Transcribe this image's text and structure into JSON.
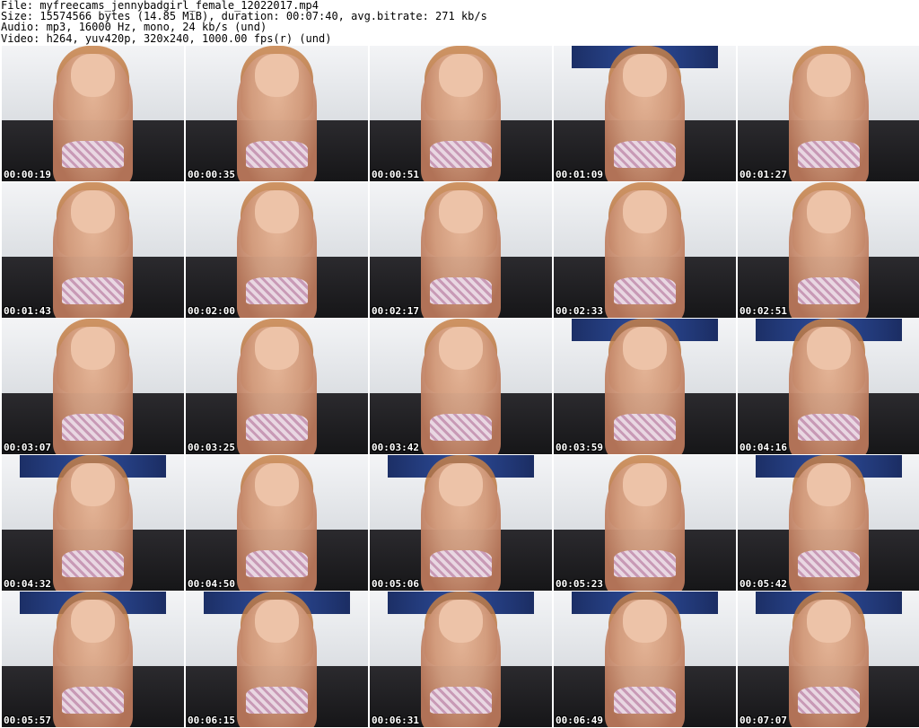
{
  "header": {
    "file": "File: myfreecams_jennybadgirl_female_12022017.mp4",
    "size": "Size: 15574566 bytes (14.85 MiB), duration: 00:07:40, avg.bitrate: 271 kb/s",
    "audio": "Audio: mp3, 16000 Hz, mono, 24 kb/s (und)",
    "video": "Video: h264, yuv420p, 320x240, 1000.00 fps(r) (und)"
  },
  "thumbnails": [
    {
      "time": "00:00:19"
    },
    {
      "time": "00:00:35"
    },
    {
      "time": "00:00:51"
    },
    {
      "time": "00:01:09"
    },
    {
      "time": "00:01:27"
    },
    {
      "time": "00:01:43"
    },
    {
      "time": "00:02:00"
    },
    {
      "time": "00:02:17"
    },
    {
      "time": "00:02:33"
    },
    {
      "time": "00:02:51"
    },
    {
      "time": "00:03:07"
    },
    {
      "time": "00:03:25"
    },
    {
      "time": "00:03:42"
    },
    {
      "time": "00:03:59"
    },
    {
      "time": "00:04:16"
    },
    {
      "time": "00:04:32"
    },
    {
      "time": "00:04:50"
    },
    {
      "time": "00:05:06"
    },
    {
      "time": "00:05:23"
    },
    {
      "time": "00:05:42"
    },
    {
      "time": "00:05:57"
    },
    {
      "time": "00:06:15"
    },
    {
      "time": "00:06:31"
    },
    {
      "time": "00:06:49"
    },
    {
      "time": "00:07:07"
    }
  ]
}
